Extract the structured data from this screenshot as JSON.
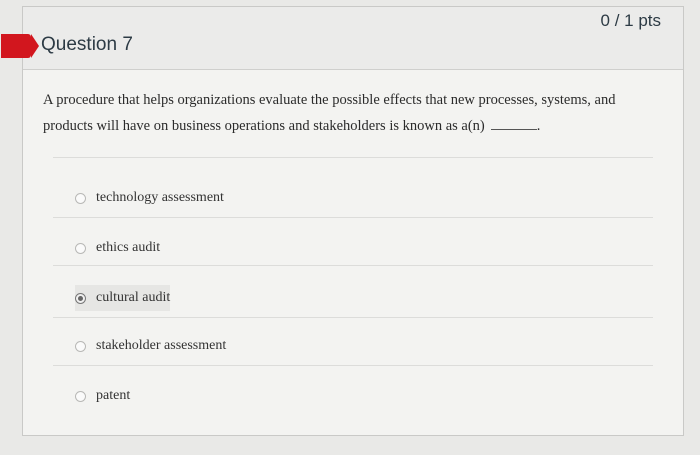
{
  "question": {
    "title": "Question 7",
    "points": "0 / 1 pts",
    "text": "A procedure that helps organizations evaluate the possible effects that new processes, systems, and products will have on business operations and stakeholders is known as a(n)",
    "text_end": "."
  },
  "answers": [
    {
      "label": "technology assessment",
      "selected": false
    },
    {
      "label": "ethics audit",
      "selected": false
    },
    {
      "label": "cultural audit",
      "selected": true
    },
    {
      "label": "stakeholder assessment",
      "selected": false
    },
    {
      "label": "patent",
      "selected": false
    }
  ],
  "colors": {
    "flag": "#d2161e",
    "text": "#2d3b45"
  }
}
